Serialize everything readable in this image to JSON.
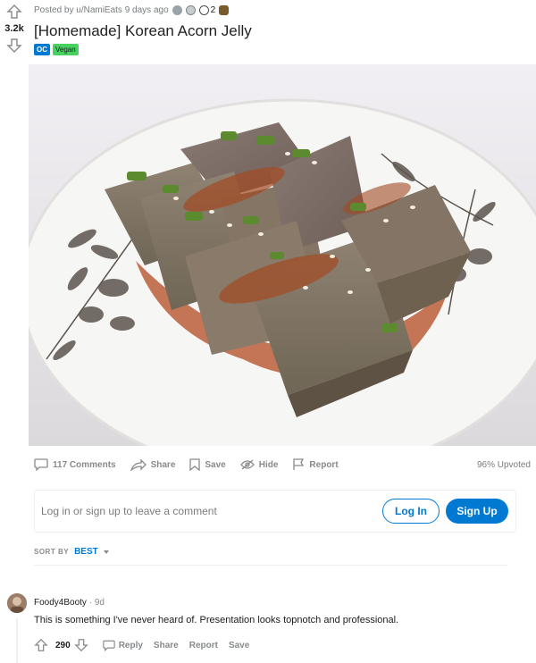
{
  "vote": {
    "score": "3.2k"
  },
  "post": {
    "meta": "Posted by u/NamiEats 9 days ago",
    "award_count": "2",
    "title": "[Homemade] Korean Acorn Jelly",
    "flairs": [
      "OC",
      "Vegan"
    ]
  },
  "actions": {
    "comments": "117 Comments",
    "share": "Share",
    "save": "Save",
    "hide": "Hide",
    "report": "Report",
    "upvoted": "96% Upvoted"
  },
  "login": {
    "prompt": "Log in or sign up to leave a comment",
    "login_label": "Log In",
    "signup_label": "Sign Up"
  },
  "sort": {
    "label": "SORT BY",
    "value": "BEST"
  },
  "comment": {
    "author": "Foody4Booty",
    "time": "9d",
    "body": "This is something I've never heard of. Presentation looks topnotch and professional.",
    "score": "290",
    "reply": "Reply",
    "share": "Share",
    "report": "Report",
    "save": "Save"
  },
  "colors": {
    "accent": "#0079d3",
    "vegan_flair": "#46d160"
  },
  "icons": [
    "upvote-icon",
    "downvote-icon",
    "comment-icon",
    "share-icon",
    "save-icon",
    "hide-icon",
    "report-icon",
    "chevron-down-icon"
  ]
}
